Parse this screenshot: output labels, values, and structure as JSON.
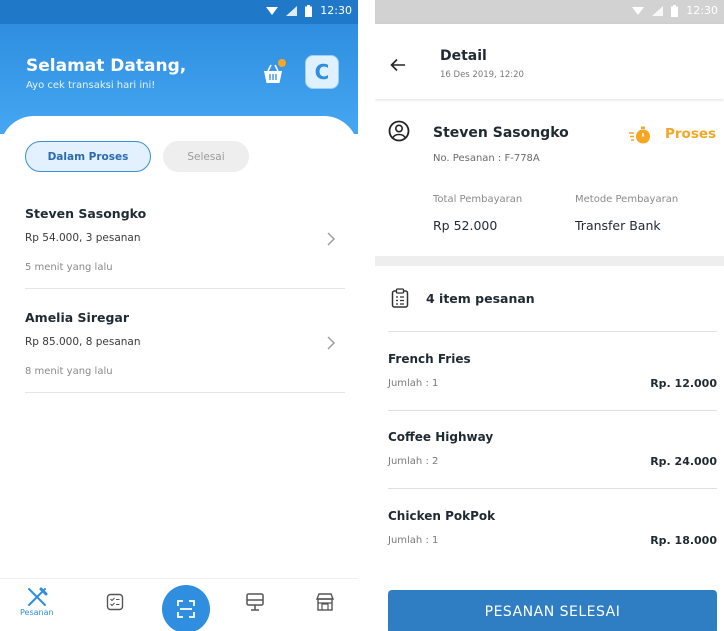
{
  "status_bar": {
    "time": "12:30"
  },
  "home": {
    "greeting": "Selamat Datang,",
    "subtitle": "Ayo cek transaksi hari ini!",
    "avatar_initial": "C",
    "tabs": [
      {
        "label": "Dalam Proses",
        "active": true
      },
      {
        "label": "Selesai",
        "active": false
      }
    ],
    "orders": [
      {
        "name": "Steven Sasongko",
        "summary": "Rp 54.000, 3 pesanan",
        "time": "5 menit yang lalu"
      },
      {
        "name": "Amelia Siregar",
        "summary": "Rp 85.000, 8 pesanan",
        "time": "8 menit yang lalu"
      }
    ],
    "bottom_nav": [
      {
        "label": "Pesanan",
        "icon": "cutlery-icon",
        "active": true
      },
      {
        "label": "",
        "icon": "checklist-icon",
        "active": false
      },
      {
        "label": "",
        "icon": "scan-icon",
        "active": false
      },
      {
        "label": "",
        "icon": "menu-board-icon",
        "active": false
      },
      {
        "label": "",
        "icon": "store-icon",
        "active": false
      }
    ]
  },
  "detail": {
    "title": "Detail",
    "datetime": "16 Des 2019, 12:20",
    "customer": "Steven Sasongko",
    "order_no": "No. Pesanan :  F-778A",
    "status": "Proses",
    "total_label": "Total Pembayaran",
    "total_value": "Rp 52.000",
    "method_label": "Metode Pembayaran",
    "method_value": "Transfer Bank",
    "items_title": "4 item pesanan",
    "items": [
      {
        "name": "French Fries",
        "qty": "Jumlah : 1",
        "price": "Rp. 12.000"
      },
      {
        "name": "Coffee Highway",
        "qty": "Jumlah : 2",
        "price": "Rp. 24.000"
      },
      {
        "name": "Chicken PokPok",
        "qty": "Jumlah : 1",
        "price": "Rp. 18.000"
      }
    ],
    "button_label": "PESANAN SELESAI"
  },
  "colors": {
    "primary": "#2f8ee0",
    "status_orange": "#f5a623",
    "button": "#2f7ec4"
  }
}
